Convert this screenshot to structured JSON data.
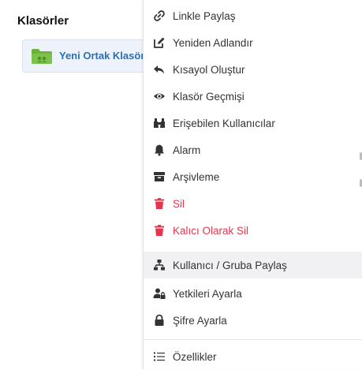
{
  "sidebar": {
    "title": "Klasörler",
    "folder": {
      "name": "Yeni Ortak Klasör"
    }
  },
  "context_menu": {
    "items": [
      {
        "label": "Linkle Paylaş",
        "icon": "link-icon"
      },
      {
        "label": "Yeniden Adlandır",
        "icon": "edit-icon"
      },
      {
        "label": "Kısayol Oluştur",
        "icon": "shortcut-arrow-icon"
      },
      {
        "label": "Klasör Geçmişi",
        "icon": "eye-icon"
      },
      {
        "label": "Erişebilen Kullanıcılar",
        "icon": "binoculars-icon"
      },
      {
        "label": "Alarm",
        "icon": "bell-icon"
      },
      {
        "label": "Arşivleme",
        "icon": "archive-icon"
      },
      {
        "label": "Sil",
        "icon": "trash-icon"
      },
      {
        "label": "Kalıcı Olarak Sil",
        "icon": "trash-icon"
      },
      {
        "label": "Kullanıcı / Gruba Paylaş",
        "icon": "network-icon"
      },
      {
        "label": "Yetkileri Ayarla",
        "icon": "user-lock-icon"
      },
      {
        "label": "Şifre Ayarla",
        "icon": "lock-icon"
      },
      {
        "label": "Özellikler",
        "icon": "list-icon"
      }
    ]
  },
  "colors": {
    "danger": "#e8334e",
    "text": "#333333",
    "folder_green": "#6bb33c",
    "folder_link": "#2d6fb3"
  }
}
